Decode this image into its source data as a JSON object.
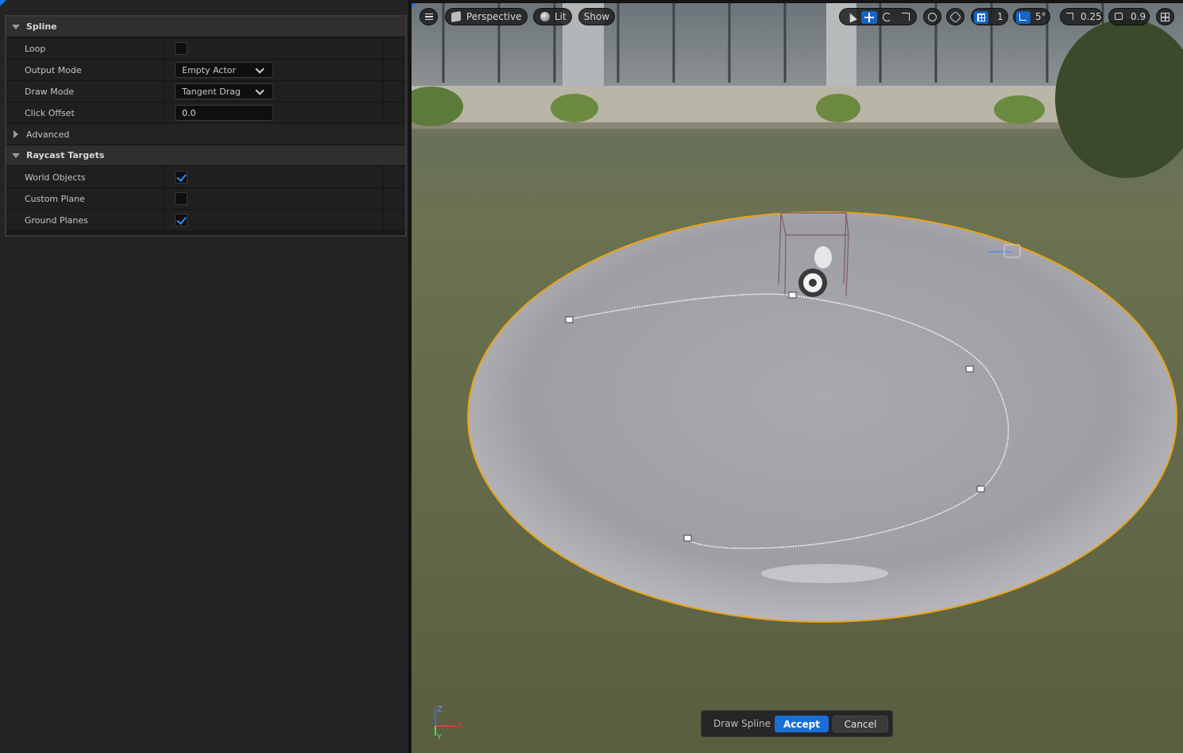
{
  "details": {
    "spline_category": {
      "label": "Spline"
    },
    "loop": {
      "label": "Loop",
      "checked": false
    },
    "output_mode": {
      "label": "Output Mode",
      "value": "Empty Actor"
    },
    "draw_mode": {
      "label": "Draw Mode",
      "value": "Tangent Drag"
    },
    "click_offset": {
      "label": "Click Offset",
      "value": "0.0"
    },
    "advanced": {
      "label": "Advanced"
    },
    "raycast_category": {
      "label": "Raycast Targets"
    },
    "world_objects": {
      "label": "World Objects",
      "checked": true
    },
    "custom_plane": {
      "label": "Custom Plane",
      "checked": false
    },
    "ground_planes": {
      "label": "Ground Planes",
      "checked": true
    }
  },
  "viewport_toolbar": {
    "menu_icon": "hamburger-icon",
    "perspective": "Perspective",
    "lit": "Lit",
    "show": "Show",
    "grid_snap": "1",
    "rotation_snap": "5°",
    "scale_snap": "0.25",
    "camera_speed": "0.9"
  },
  "draw_spline_bar": {
    "label": "Draw Spline",
    "accept": "Accept",
    "cancel": "Cancel"
  },
  "axis_gizmo": {
    "x": "X",
    "y": "Y",
    "z": "Z"
  },
  "colors": {
    "accent": "#1a6fd6",
    "selection_outline": "#e8a317",
    "checkbox_check": "#2b8cff"
  }
}
